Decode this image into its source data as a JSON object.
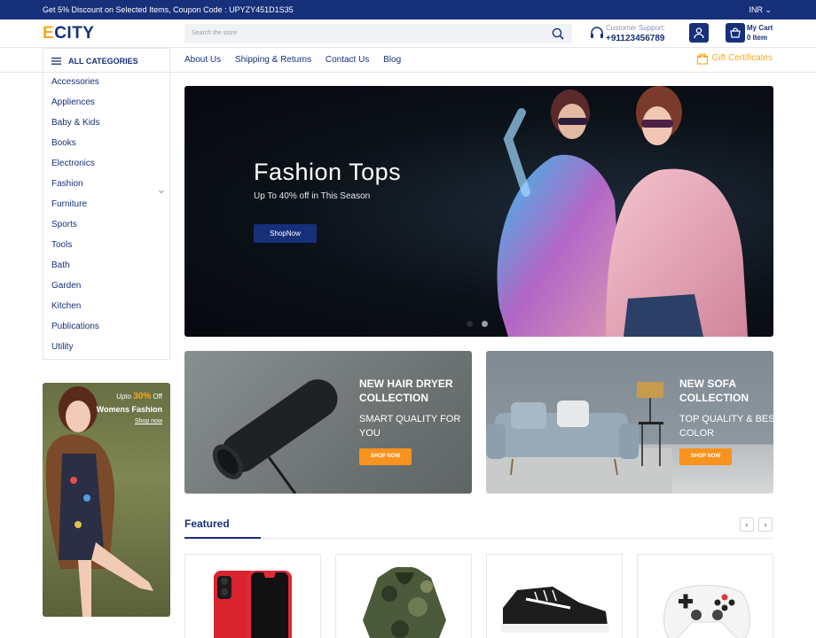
{
  "topbar": {
    "promo": "Get 5% Discount on Selected Items, Coupon Code : UPYZY451D1S35",
    "currency": "INR"
  },
  "header": {
    "logo_e": "E",
    "logo_rest": "CITY",
    "search_placeholder": "Search the store",
    "support_label": "Customer Support:",
    "support_number": "+91123456789",
    "cart_label": "My Cart",
    "cart_count": "0 Item"
  },
  "nav": {
    "all_categories": "ALL CATEGORIES",
    "links": [
      "About Us",
      "Shipping & Returns",
      "Contact Us",
      "Blog"
    ],
    "gift": "Gift Certificates"
  },
  "categories": [
    "Accessories",
    "Appliences",
    "Baby & Kids",
    "Books",
    "Electronics",
    "Fashion",
    "Furniture",
    "Sports",
    "Tools",
    "Bath",
    "Garden",
    "Kitchen",
    "Publications",
    "Utility"
  ],
  "hero": {
    "title": "Fashion Tops",
    "subtitle": "Up To 40% off in This Season",
    "button": "ShopNow"
  },
  "banners": [
    {
      "title": "NEW HAIR DRYER COLLECTION",
      "subtitle": "SMART QUALITY FOR YOU",
      "button": "SHOP NOW"
    },
    {
      "title": "NEW SOFA COLLECTION",
      "subtitle": "TOP QUALITY & BEST COLOR",
      "button": "SHOP NOW"
    }
  ],
  "sidead": {
    "upto": "Upto",
    "percent": "30%",
    "off": "Off",
    "title": "Womens Fashion",
    "shop": "Shop now"
  },
  "featured": {
    "title": "Featured",
    "prev": "‹",
    "next": "›"
  },
  "colors": {
    "primary": "#16307a",
    "accent": "#f7a823",
    "button_orange": "#f7931e"
  }
}
